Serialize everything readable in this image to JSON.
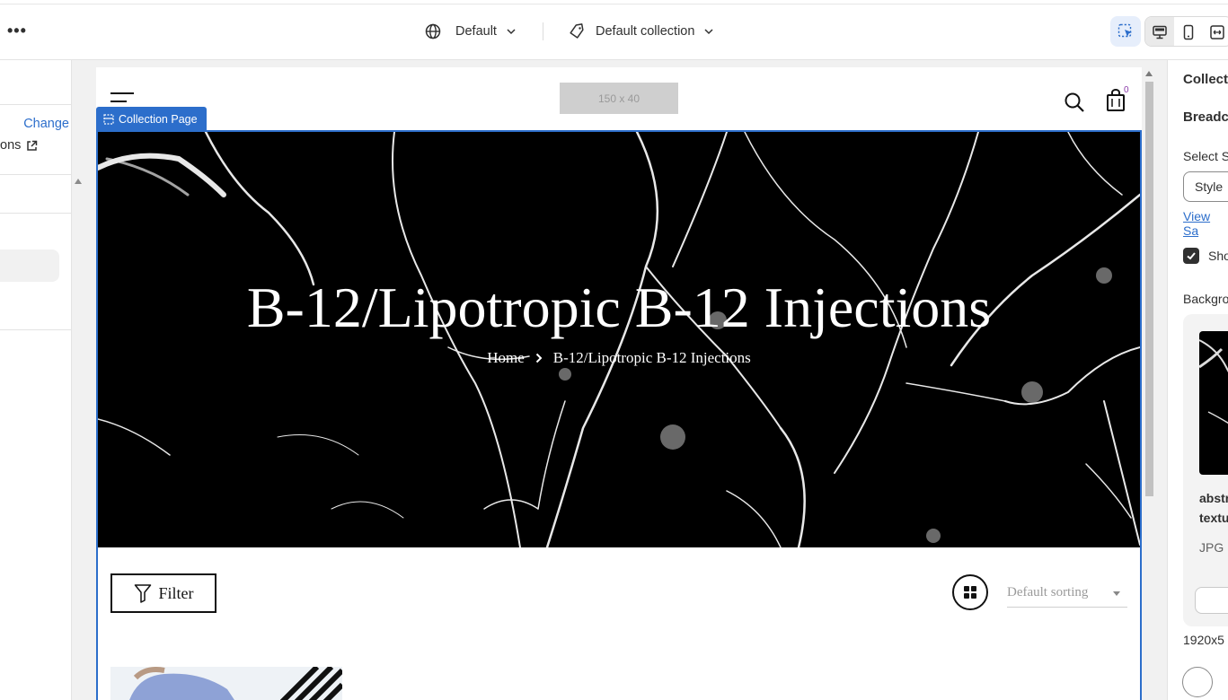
{
  "topbar": {
    "more_label": "•••",
    "language": "Default",
    "template": "Default collection"
  },
  "leftpanel": {
    "change_link": "Change",
    "truncated_link": "ons"
  },
  "preview": {
    "logo_placeholder": "150 x 40",
    "cart_count": "0",
    "section_tag": "Collection Page",
    "hero_title": "B-12/Lipotropic B-12 Injections",
    "breadcrumbs": [
      "Home",
      "B-12/Lipotropic B-12 Injections"
    ],
    "filter_label": "Filter",
    "sorting_label": "Default sorting"
  },
  "rightpanel": {
    "section_title": "Collect",
    "subsection": "Breadc",
    "select_label": "Select S",
    "select_value": "Style",
    "view_link": "View Sa",
    "checkbox_label": "Sho",
    "background_label": "Backgro",
    "image_name_1": "abstr",
    "image_name_2": "textu",
    "image_type": "JPG",
    "image_size": "1920x5"
  },
  "colors": {
    "accent": "#2c6ecb",
    "hero_bg": "#000000",
    "cart_badge": "#8a3aa8"
  }
}
